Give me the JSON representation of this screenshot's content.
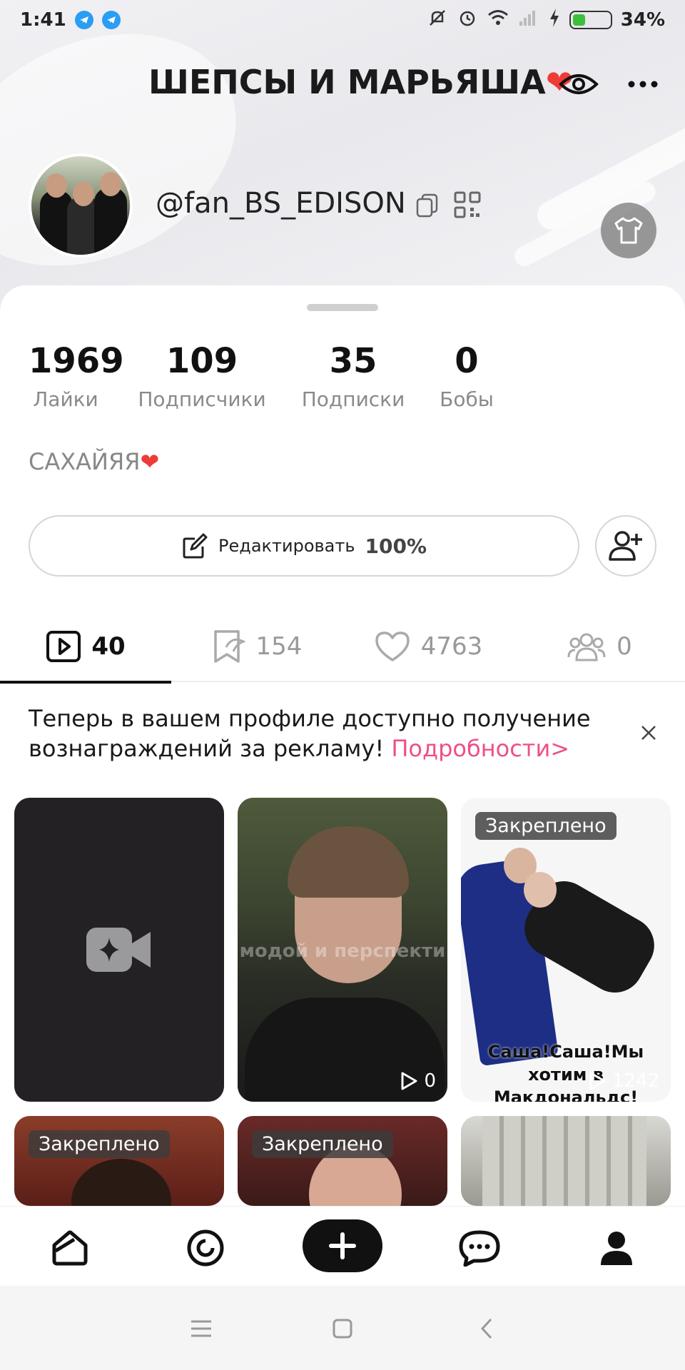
{
  "status_bar": {
    "time": "1:41",
    "battery": "34%"
  },
  "header": {
    "title": "ШЕПСЫ И МАРЬЯША",
    "title_emoji": "❤"
  },
  "profile": {
    "username": "@fan_BS_EDISON"
  },
  "stats": [
    {
      "value": "1969",
      "label": "Лайки"
    },
    {
      "value": "109",
      "label": "Подписчики"
    },
    {
      "value": "35",
      "label": "Подписки"
    },
    {
      "value": "0",
      "label": "Бобы"
    }
  ],
  "bio": {
    "text": "САХАЙЯЯ",
    "emoji": "❤"
  },
  "edit_button": {
    "label": "Редактировать",
    "progress": "𝟭𝟬𝟬%"
  },
  "tabs": [
    {
      "icon": "play-square-icon",
      "count": "40"
    },
    {
      "icon": "bookmark-icon",
      "count": "154"
    },
    {
      "icon": "heart-icon",
      "count": "4763"
    },
    {
      "icon": "group-icon",
      "count": "0"
    }
  ],
  "banner": {
    "text": "Теперь в вашем профиле доступно получение вознаграждений за рекламу! ",
    "link": "Подробности>"
  },
  "videos": [
    {
      "type": "new",
      "icon": "video-plus-icon"
    },
    {
      "overlay_text": "модой и перспекти",
      "views": "0"
    },
    {
      "pinned": "Закреплено",
      "caption": "Саша!Саша!Мы хотим в Макдональдс!",
      "views": "1242"
    },
    {
      "pinned": "Закреплено"
    },
    {
      "pinned": "Закреплено"
    },
    {}
  ],
  "bottom_nav": [
    "home-icon",
    "discover-icon",
    "plus-icon",
    "messages-icon",
    "profile-icon"
  ],
  "colors": {
    "accent_link": "#ee4f8a",
    "heart": "#ef3b36",
    "telegram": "#2a9df4"
  }
}
